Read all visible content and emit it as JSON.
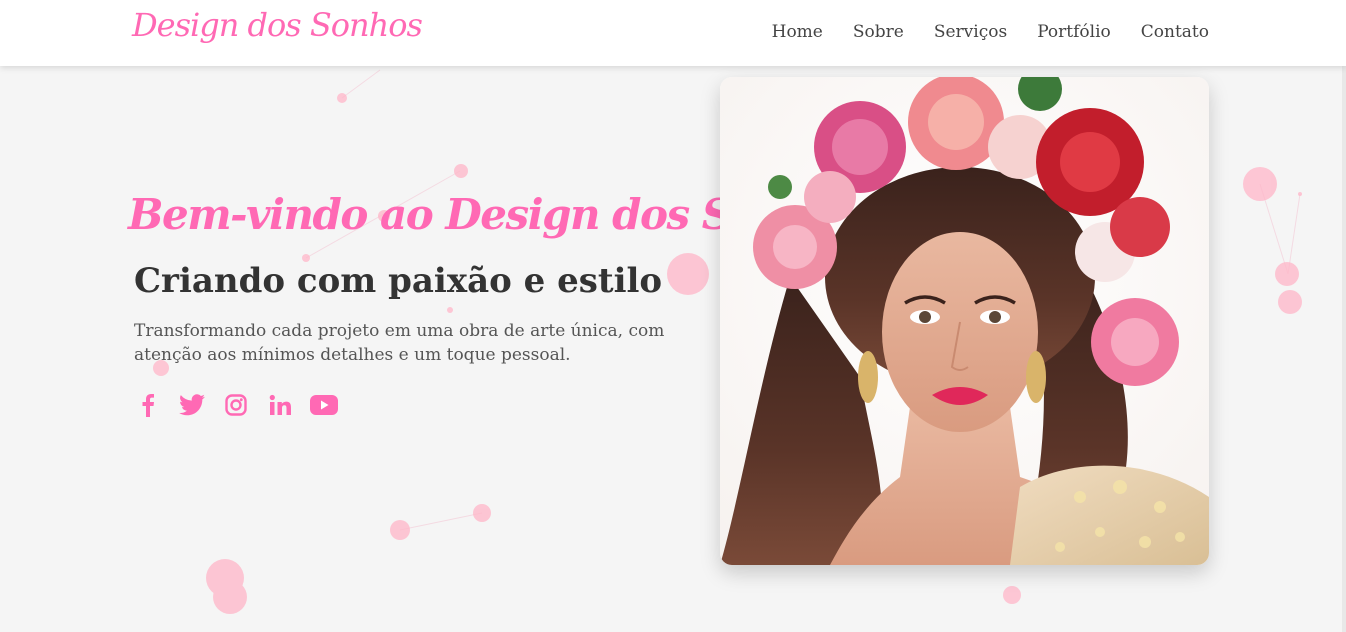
{
  "brand": {
    "logo_text": "Design dos Sonhos",
    "accent": "#ff69b4"
  },
  "nav": {
    "links": [
      "Home",
      "Sobre",
      "Serviços",
      "Portfólio",
      "Contato"
    ]
  },
  "hero": {
    "welcome": "Bem-vindo ao Design dos Sonhos",
    "headline": "Criando com paixão e estilo",
    "tagline": "Transformando cada projeto em uma obra de arte única, com atenção aos mínimos detalhes e um toque pessoal.",
    "socials": [
      "facebook-icon",
      "twitter-icon",
      "instagram-icon",
      "linkedin-icon",
      "youtube-icon"
    ],
    "image": "portrait-woman-flower-crown"
  },
  "colors": {
    "background": "#f5f5f5",
    "heading": "#333333",
    "text": "#555555",
    "particle": "#ffb6c8"
  }
}
